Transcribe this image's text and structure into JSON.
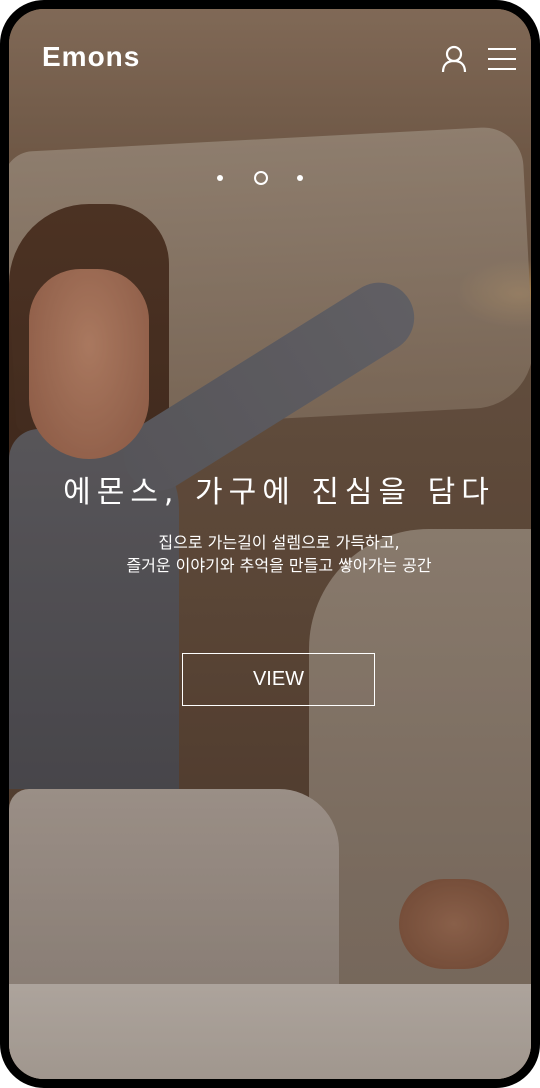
{
  "brand": {
    "logo_text": "Emons"
  },
  "header": {
    "user_icon": "user-icon",
    "menu_icon": "hamburger-menu-icon"
  },
  "carousel": {
    "slide_count": 3,
    "active_index": 1
  },
  "hero": {
    "headline": "에몬스, 가구에 진심을 담다",
    "subline_1": "집으로 가는길이 설렘으로 가득하고,",
    "subline_2": "즐거운 이야기와 추억을 만들고 쌓아가는 공간",
    "button_label": "VIEW"
  },
  "colors": {
    "text": "#ffffff",
    "frame": "#000000"
  }
}
